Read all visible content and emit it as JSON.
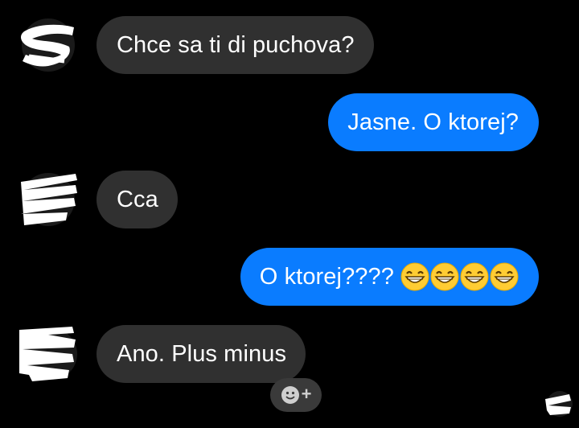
{
  "messages": [
    {
      "direction": "incoming",
      "text": "Chce sa ti di puchova?"
    },
    {
      "direction": "outgoing",
      "text": "Jasne. O ktorej?"
    },
    {
      "direction": "incoming",
      "text": "Cca"
    },
    {
      "direction": "outgoing",
      "text": "O ktorej????",
      "emoji": [
        "grinning-face-icon",
        "grinning-face-icon",
        "grinning-face-icon",
        "grinning-face-icon"
      ]
    },
    {
      "direction": "incoming",
      "text": "Ano. Plus minus"
    }
  ],
  "reaction_button": {
    "icon": "smiley-add-icon",
    "plus": "+"
  },
  "colors": {
    "background": "#000000",
    "incoming_bubble": "#303030",
    "outgoing_bubble": "#0a7cff",
    "text": "#ffffff"
  }
}
